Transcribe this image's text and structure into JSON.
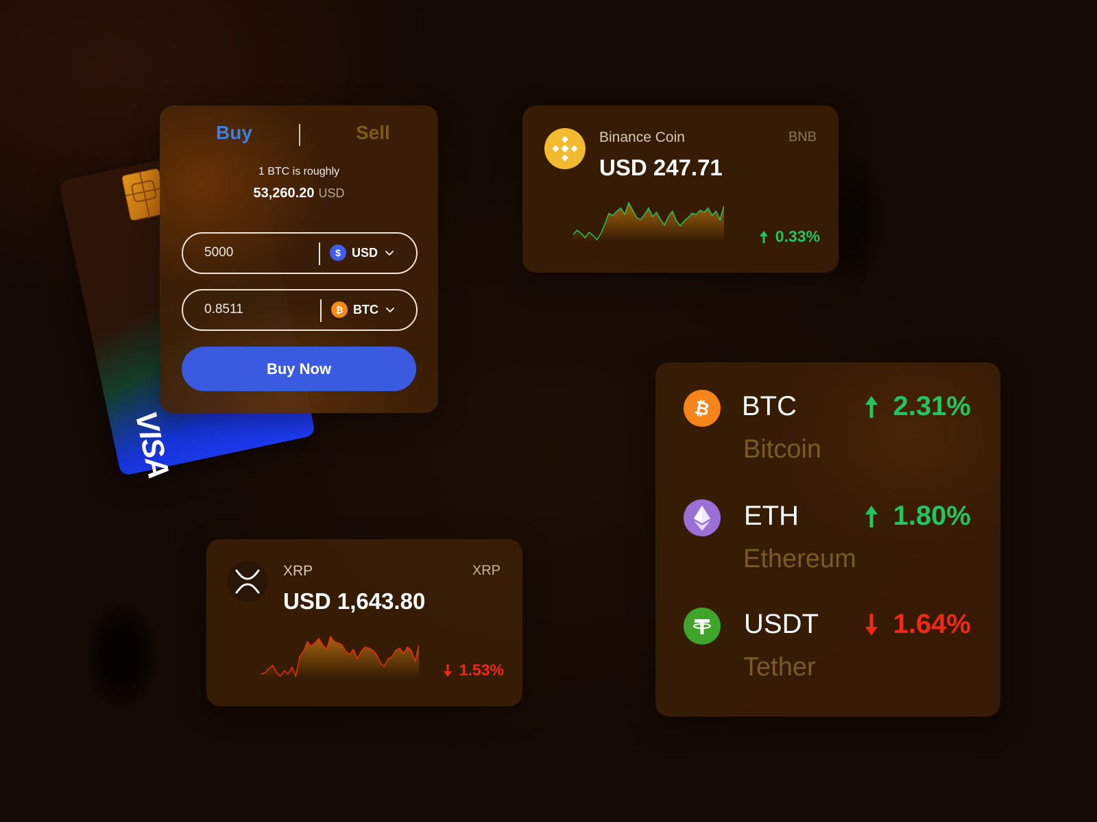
{
  "trade_widget": {
    "tabs": {
      "buy": "Buy",
      "sell": "Sell"
    },
    "rate_label": "1 BTC is roughly",
    "rate_value": "53,260.20",
    "rate_unit": "USD",
    "pay_field": {
      "value": "5000",
      "currency": "USD",
      "icon": "dollar-icon"
    },
    "receive_field": {
      "value": "0.8511",
      "currency": "BTC",
      "icon": "bitcoin-icon"
    },
    "buy_button": "Buy Now"
  },
  "card": {
    "brand": "VISA"
  },
  "price_cards": [
    {
      "name": "Binance Coin",
      "symbol": "BNB",
      "price": "USD 247.71",
      "change": "0.33%",
      "direction": "up",
      "icon": "binance-icon",
      "sparkline": [
        8,
        12,
        9,
        5,
        10,
        7,
        3,
        9,
        18,
        28,
        26,
        30,
        33,
        27,
        38,
        31,
        24,
        22,
        27,
        33,
        25,
        29,
        22,
        17,
        25,
        30,
        21,
        16,
        21,
        24,
        28,
        27,
        31,
        29,
        33,
        26,
        30,
        22,
        35
      ]
    },
    {
      "name": "XRP",
      "symbol": "XRP",
      "price": "USD 1,643.80",
      "change": "1.53%",
      "direction": "down",
      "icon": "xrp-icon",
      "sparkline": [
        6,
        7,
        11,
        14,
        7,
        4,
        9,
        6,
        12,
        4,
        22,
        27,
        36,
        32,
        35,
        39,
        33,
        29,
        41,
        36,
        35,
        33,
        27,
        24,
        29,
        20,
        27,
        31,
        30,
        28,
        24,
        16,
        13,
        20,
        22,
        28,
        30,
        25,
        31,
        28,
        18,
        33
      ]
    }
  ],
  "market_list": [
    {
      "symbol": "BTC",
      "name": "Bitcoin",
      "change": "2.31%",
      "direction": "up",
      "icon": "bitcoin-icon"
    },
    {
      "symbol": "ETH",
      "name": "Ethereum",
      "change": "1.80%",
      "direction": "up",
      "icon": "ethereum-icon"
    },
    {
      "symbol": "USDT",
      "name": "Tether",
      "change": "1.64%",
      "direction": "down",
      "icon": "tether-icon"
    }
  ],
  "colors": {
    "up": "#22c55e",
    "down": "#ef2b13",
    "buy_accent": "#3a5bdf",
    "bnb_gold": "#f3ba2f"
  }
}
